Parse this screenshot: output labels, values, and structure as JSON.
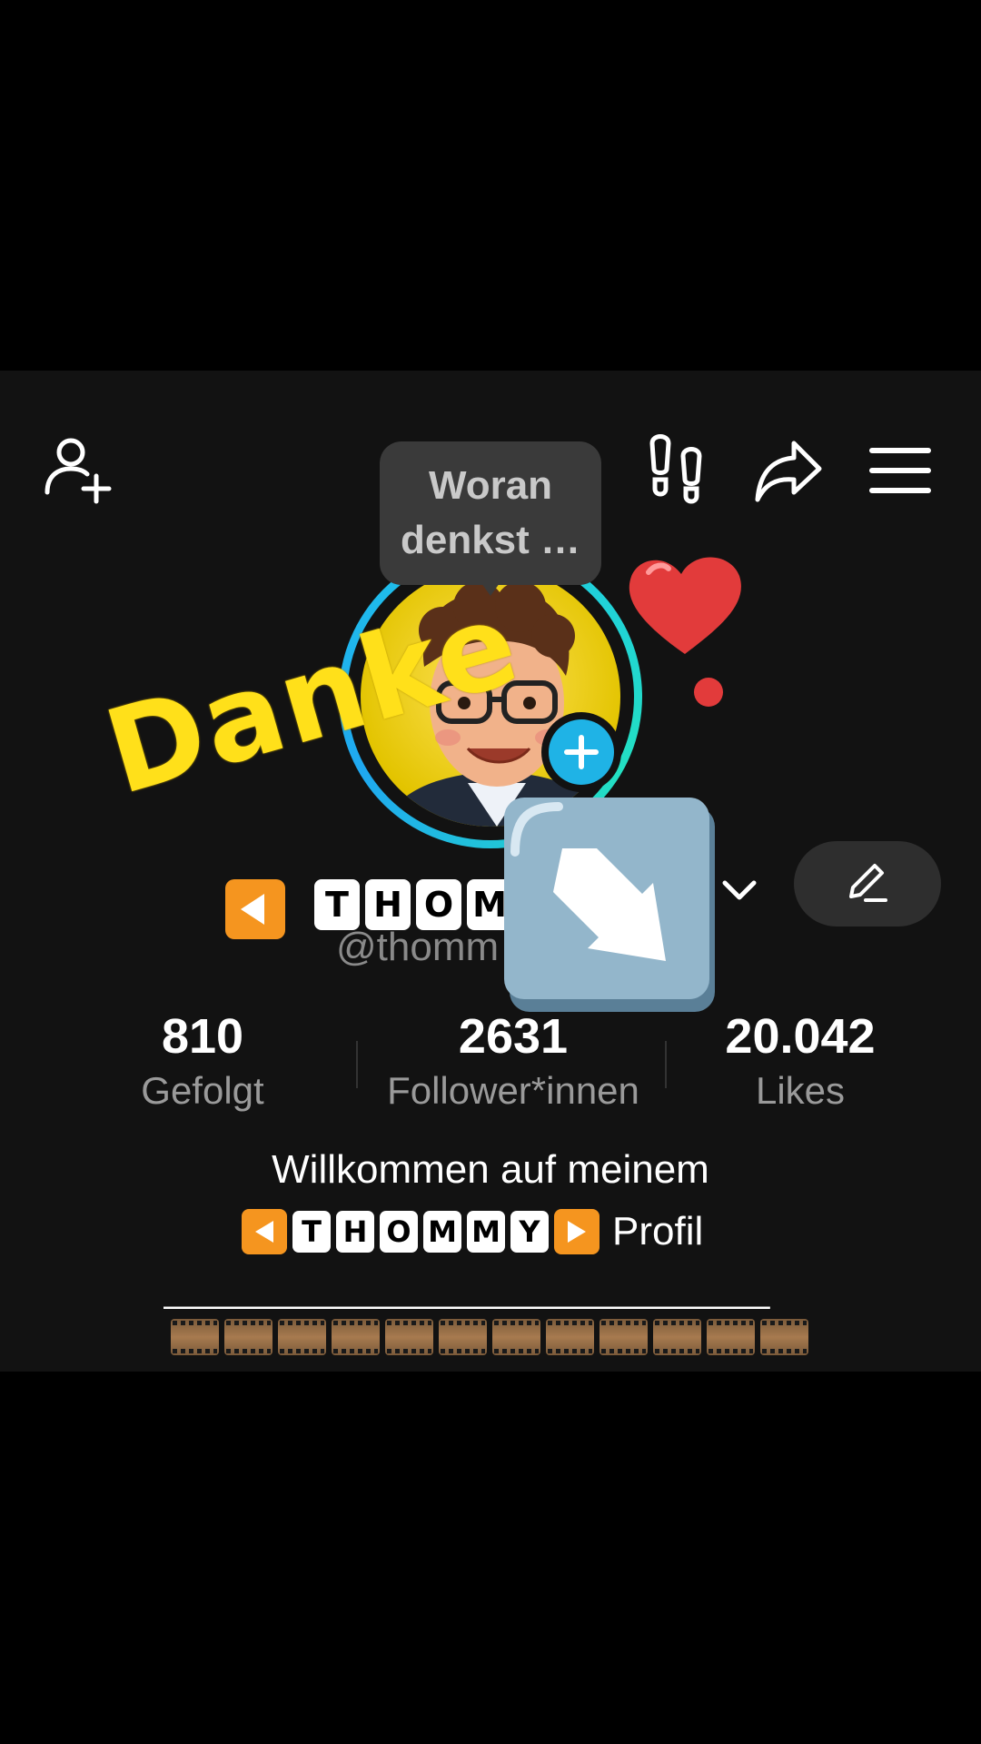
{
  "bubble": {
    "line1": "Woran",
    "line2": "denkst …"
  },
  "sticker_text": "Danke",
  "profile": {
    "name_letters": [
      "T",
      "H",
      "O",
      "M"
    ],
    "handle": "@thomm"
  },
  "stats": [
    {
      "value": "810",
      "label": "Gefolgt"
    },
    {
      "value": "2631",
      "label": "Follower*innen"
    },
    {
      "value": "20.042",
      "label": "Likes"
    }
  ],
  "bio": {
    "line1": "Willkommen auf meinem",
    "letters": [
      "T",
      "H",
      "O",
      "M",
      "M",
      "Y"
    ],
    "suffix": "Profil",
    "dashes": "______________________________",
    "film_count": 12
  },
  "icons": {
    "top_left": "add-user-icon",
    "top_right": [
      "footprints-icon",
      "share-icon",
      "menu-icon"
    ],
    "edit": "pencil-icon",
    "chevron": "chevron-down-icon"
  },
  "colors": {
    "accent_ring": "#1fc7e8",
    "sticker_yellow": "#ffe01a",
    "play_orange": "#f5951f"
  }
}
